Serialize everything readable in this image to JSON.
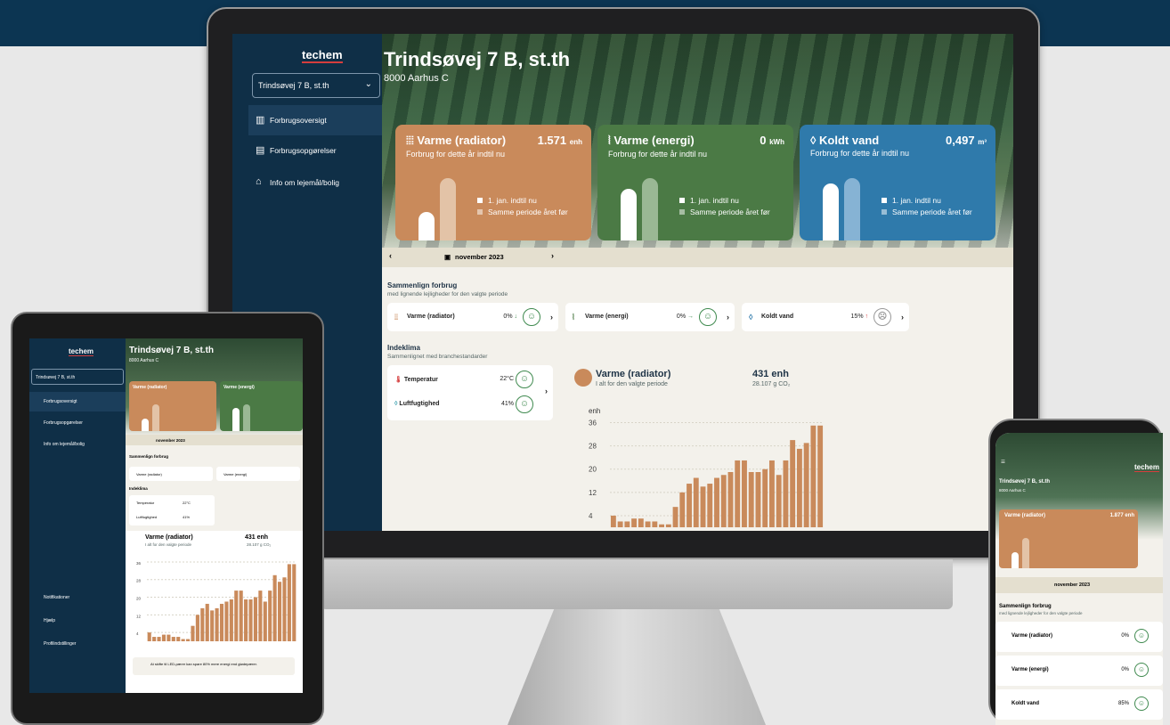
{
  "app": {
    "logo": "techem",
    "address_select": "Trindsøvej 7 B, st.th",
    "title": "Trindsøvej 7 B, st.th",
    "city": "8000 Aarhus C"
  },
  "sidebar": {
    "items": [
      {
        "label": "Forbrugsoversigt",
        "icon": "chart-icon"
      },
      {
        "label": "Forbrugsopgørelser",
        "icon": "document-icon"
      },
      {
        "label": "Info om lejemål/bolig",
        "icon": "home-icon"
      }
    ],
    "bottom_items": [
      {
        "label": "Notifikationer"
      },
      {
        "label": "Hjælp"
      },
      {
        "label": "Profilindstillinger"
      }
    ]
  },
  "cards": [
    {
      "title": "Varme (radiator)",
      "value": "1.571",
      "unit": "enh",
      "subtitle": "Forbrug for dette år indtil nu",
      "color": "#c98a5b",
      "bar2": "#e3c3a7",
      "current": 0.55,
      "previous": 1.0
    },
    {
      "title": "Varme (energi)",
      "value": "0",
      "unit": "kWh",
      "subtitle": "Forbrug for dette år indtil nu",
      "color": "#4b7a45",
      "bar2": "#9ab894",
      "current": 0.9,
      "previous": 1.0
    },
    {
      "title": "Koldt vand",
      "value": "0,497",
      "unit": "m³",
      "subtitle": "Forbrug for dette år indtil nu",
      "color": "#2f7aab",
      "bar2": "#86b3d4",
      "current": 0.9,
      "previous": 1.0
    }
  ],
  "legend": {
    "current": "1. jan. indtil nu",
    "previous": "Samme periode året før"
  },
  "datebar": {
    "month": "november 2023",
    "prev": "‹",
    "next": "›"
  },
  "compare": {
    "title": "Sammenlign forbrug",
    "subtitle": "med lignende lejligheder for den valgte periode",
    "items": [
      {
        "label": "Varme (radiator)",
        "pct": "0%",
        "arrow": "↓",
        "face": "☺"
      },
      {
        "label": "Varme (energi)",
        "pct": "0%",
        "arrow": "→",
        "face": "☺"
      },
      {
        "label": "Koldt vand",
        "pct": "15%",
        "arrow": "↑",
        "face": "☹"
      }
    ]
  },
  "indoor": {
    "title": "Indeklima",
    "subtitle": "Sammenlignet med branchestandarder",
    "items": [
      {
        "label": "Temperatur",
        "value": "22°C"
      },
      {
        "label": "Luftfugtighed",
        "value": "41%"
      }
    ]
  },
  "chart_panel": {
    "title": "Varme (radiator)",
    "subtitle": "I alt for den valgte periode",
    "total": "431 enh",
    "co2": "28.107 g CO₂"
  },
  "chart_data": {
    "type": "bar",
    "ylabel": "enh",
    "ylim": [
      0,
      38
    ],
    "yticks": [
      4,
      12,
      20,
      28,
      36
    ],
    "values": [
      4,
      2,
      2,
      3,
      3,
      2,
      2,
      1,
      1,
      7,
      12,
      15,
      17,
      14,
      15,
      17,
      18,
      19,
      23,
      23,
      19,
      19,
      20,
      23,
      18,
      23,
      30,
      27,
      29,
      35,
      35
    ]
  },
  "tablet": {
    "compare_items": [
      "Varme (radiator)",
      "Varme (energi)"
    ],
    "xticks": [
      "ons., 1.11",
      "man., 6.11",
      "lør., 11.11",
      "tor., 16.11",
      "tir., 21.11",
      "søn., 26.11"
    ],
    "tip": "At skifte til LED-pærer kan spare 80% mere energi end glødepærer."
  },
  "phone": {
    "card_value": "1.877",
    "compare_items": [
      {
        "label": "Varme (radiator)",
        "pct": "0%"
      },
      {
        "label": "Varme (energi)",
        "pct": "0%"
      },
      {
        "label": "Koldt vand",
        "pct": "85%"
      }
    ]
  }
}
